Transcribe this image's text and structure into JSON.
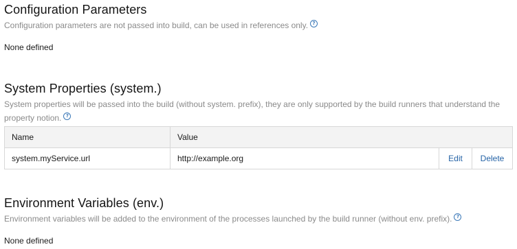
{
  "config_params": {
    "title": "Configuration Parameters",
    "description": "Configuration parameters are not passed into build, can be used in references only.",
    "empty_text": "None defined"
  },
  "system_properties": {
    "title": "System Properties (system.)",
    "description": "System properties will be passed into the build (without system. prefix), they are only supported by the build runners that understand the property notion.",
    "table": {
      "headers": [
        "Name",
        "Value"
      ],
      "rows": [
        {
          "name": "system.myService.url",
          "value": "http://example.org",
          "edit_label": "Edit",
          "delete_label": "Delete"
        }
      ]
    }
  },
  "env_variables": {
    "title": "Environment Variables (env.)",
    "description": "Environment variables will be added to the environment of the processes launched by the build runner (without env. prefix).",
    "empty_text": "None defined"
  },
  "help_icon_glyph": "?",
  "icons": {
    "help": "help-question-icon"
  },
  "colors": {
    "link": "#2563a6",
    "description": "#8a8a8a",
    "header_bg": "#f3f3f3",
    "border": "#d7d7d7"
  }
}
